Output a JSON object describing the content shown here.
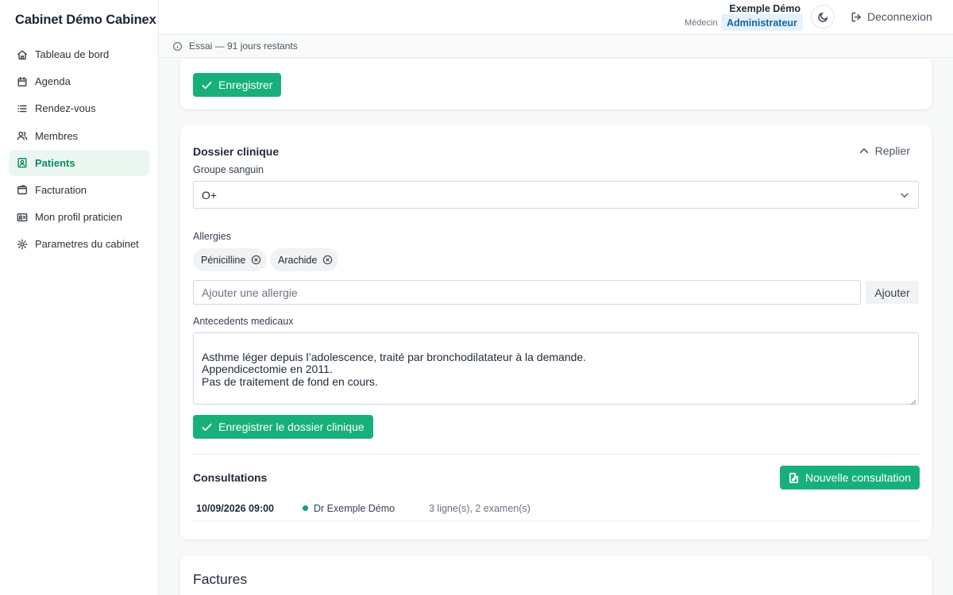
{
  "app": {
    "brand": "Cabinet Démo Cabinex"
  },
  "sidebar": {
    "items": [
      {
        "label": "Tableau de bord",
        "icon": "home-icon"
      },
      {
        "label": "Agenda",
        "icon": "calendar-icon"
      },
      {
        "label": "Rendez-vous",
        "icon": "list-icon"
      },
      {
        "label": "Membres",
        "icon": "users-icon"
      },
      {
        "label": "Patients",
        "icon": "contact-icon",
        "active": true
      },
      {
        "label": "Facturation",
        "icon": "wallet-icon"
      },
      {
        "label": "Mon profil praticien",
        "icon": "id-card-icon"
      },
      {
        "label": "Parametres du cabinet",
        "icon": "gear-icon"
      }
    ]
  },
  "header": {
    "user_name": "Exemple Démo",
    "user_role": "Médecin",
    "role_badge": "Administrateur",
    "theme_icon": "moon-icon",
    "logout_label": "Deconnexion"
  },
  "trial": {
    "text": "Essai — 91 jours restants",
    "icon": "info-icon"
  },
  "top_card": {
    "save_label": "Enregistrer"
  },
  "clinical": {
    "title": "Dossier clinique",
    "collapse_label": "Replier",
    "blood_group_label": "Groupe sanguin",
    "blood_group_value": "O+",
    "allergies_label": "Allergies",
    "allergies": [
      "Pénicilline",
      "Arachide"
    ],
    "allergy_placeholder": "Ajouter une allergie",
    "add_label": "Ajouter",
    "history_label": "Antecedents medicaux",
    "history_text": "Asthme léger depuis l’adolescence, traité par bronchodilatateur à la demande.\nAppendicectomie en 2011.\nPas de traitement de fond en cours.",
    "save_label": "Enregistrer le dossier clinique"
  },
  "consultations": {
    "title": "Consultations",
    "new_label": "Nouvelle consultation",
    "rows": [
      {
        "date": "10/09/2026 09:00",
        "doctor": "Dr Exemple Démo",
        "summary": "3 ligne(s), 2 examen(s)",
        "status_color": "#0f9a8e"
      }
    ]
  },
  "invoices": {
    "title": "Factures"
  },
  "colors": {
    "accent": "#18b07a",
    "active_text": "#0f8a5f",
    "active_bg": "#eaf7f1",
    "badge_bg": "#e6f2fb",
    "badge_text": "#0b66a8"
  }
}
